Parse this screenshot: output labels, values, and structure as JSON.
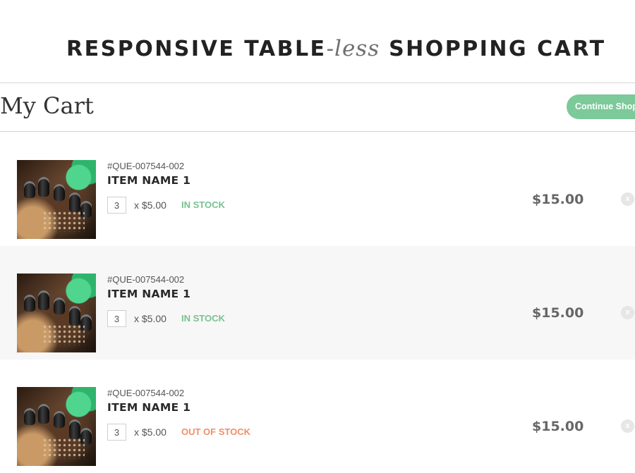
{
  "header": {
    "title_part1": "RESPONSIVE TABLE",
    "title_part2": "-less",
    "title_part3": " SHOPPING CART"
  },
  "cart": {
    "title": "My Cart",
    "continue_label": "Continue Shopping"
  },
  "items": [
    {
      "sku": "#QUE-007544-002",
      "name": "ITEM NAME 1",
      "quantity": "3",
      "unit_price_text": "x $5.00",
      "stock_status": "IN STOCK",
      "stock_state": "in",
      "line_total": "$15.00",
      "remove_label": "x",
      "image_icon": "circuit-board-image"
    },
    {
      "sku": "#QUE-007544-002",
      "name": "ITEM NAME 1",
      "quantity": "3",
      "unit_price_text": "x $5.00",
      "stock_status": "IN STOCK",
      "stock_state": "in",
      "line_total": "$15.00",
      "remove_label": "x",
      "image_icon": "circuit-board-image"
    },
    {
      "sku": "#QUE-007544-002",
      "name": "ITEM NAME 1",
      "quantity": "3",
      "unit_price_text": "x $5.00",
      "stock_status": "OUT OF STOCK",
      "stock_state": "out",
      "line_total": "$15.00",
      "remove_label": "x",
      "image_icon": "circuit-board-image"
    }
  ],
  "colors": {
    "accent_green": "#7cc99a",
    "in_stock": "#78c28f",
    "out_of_stock": "#f28f66",
    "row_alt_bg": "#f7f7f7"
  }
}
